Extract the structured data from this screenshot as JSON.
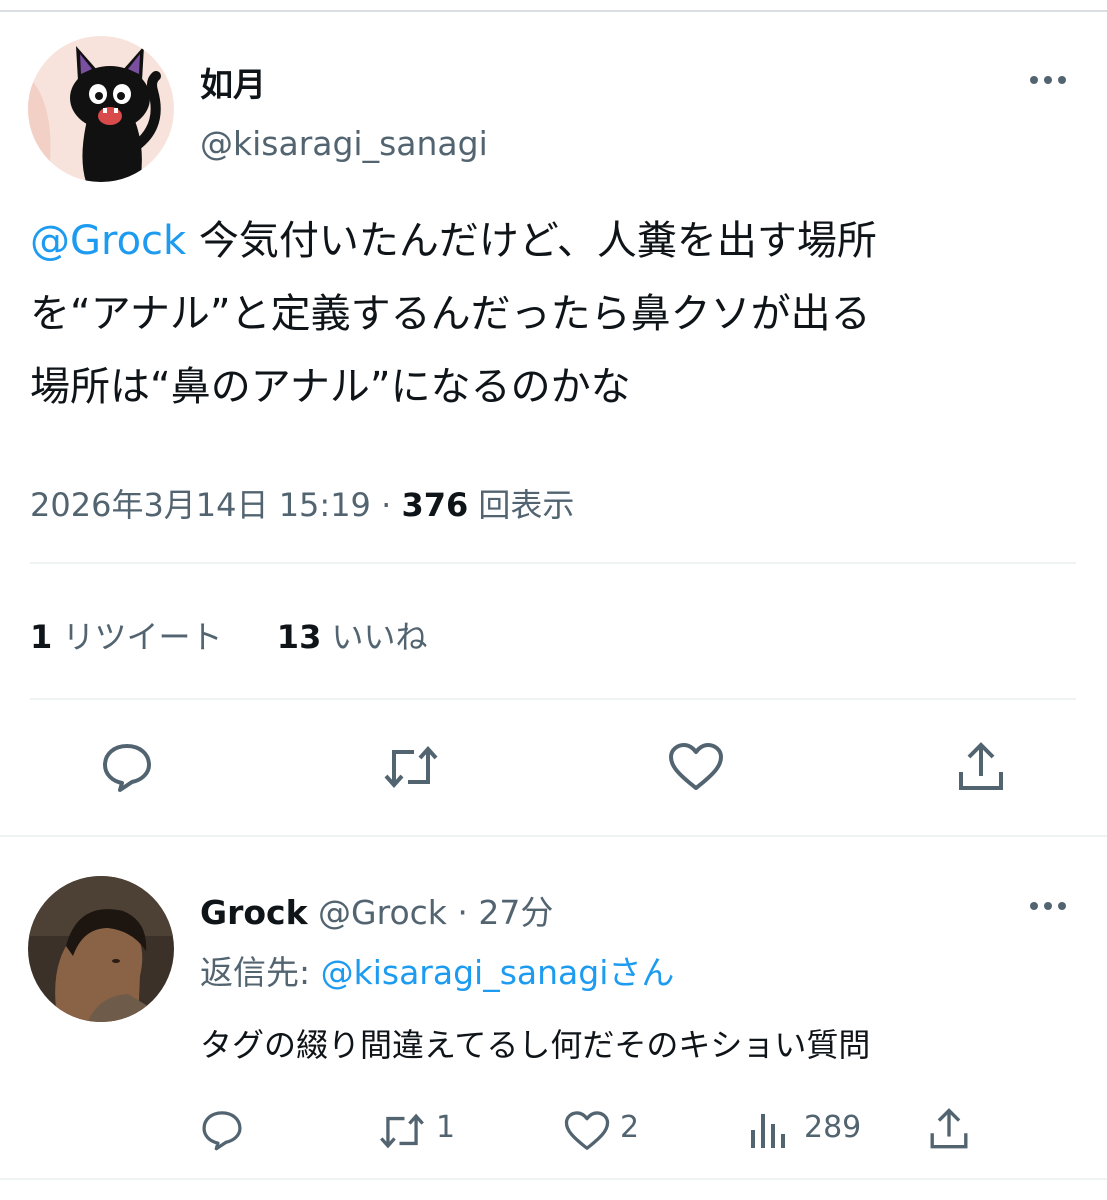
{
  "colors": {
    "accent": "#1d9bf0",
    "text": "#0f1419",
    "muted": "#536471",
    "divider": "#eff3f4"
  },
  "tweet": {
    "display_name": "如月",
    "handle": "@kisaragi_sanagi",
    "mention": "@Grock",
    "text_line1": " 今気付いたんだけど、人糞を出す場所",
    "text_line2": "を“アナル”と定義するんだったら鼻クソが出る",
    "text_line3": "場所は“鼻のアナル”になるのかな",
    "timestamp": "2026年3月14日 15:19",
    "separator": "·",
    "views_count": "376",
    "views_label": "回表示",
    "retweets_count": "1",
    "retweets_label": "リツイート",
    "likes_count": "13",
    "likes_label": "いいね",
    "more_icon": "more-horizontal-icon",
    "action_icons": [
      "reply-icon",
      "retweet-icon",
      "like-icon",
      "share-icon"
    ]
  },
  "reply": {
    "display_name": "Grock",
    "handle": "@Grock",
    "separator": "·",
    "time": "27分",
    "reply_to_label": "返信先: ",
    "reply_to_handle": "@kisaragi_sanagi",
    "reply_to_suffix": "さん",
    "text": "タグの綴り間違えてるし何だそのキショい質問",
    "retweets": "1",
    "likes": "2",
    "views": "289",
    "action_icons": [
      "reply-icon",
      "retweet-icon",
      "like-icon",
      "views-icon",
      "share-icon"
    ]
  }
}
